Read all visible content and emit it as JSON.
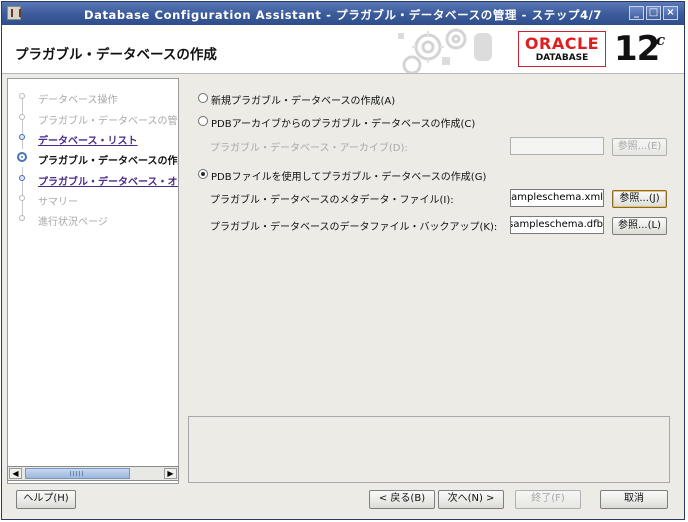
{
  "window": {
    "title": "Database Configuration Assistant - プラガブル・データベースの管理 - ステップ4/7",
    "controls": {
      "minimize": "_",
      "maximize": "□",
      "close": "×"
    }
  },
  "header": {
    "page_title": "プラガブル・データベースの作成",
    "logo_text": "ORACLE",
    "logo_sub": "DATABASE",
    "version": "12",
    "version_suffix": "c"
  },
  "steps": [
    {
      "label": "データベース操作",
      "state": "disabled"
    },
    {
      "label": "プラガブル・データベースの管理",
      "state": "disabled"
    },
    {
      "label": "データベース・リスト",
      "state": "link"
    },
    {
      "label": "プラガブル・データベースの作成",
      "state": "current"
    },
    {
      "label": "プラガブル・データベース・オプション",
      "state": "link"
    },
    {
      "label": "サマリー",
      "state": "disabled"
    },
    {
      "label": "進行状況ページ",
      "state": "disabled"
    }
  ],
  "options": {
    "new_pdb": {
      "label": "新規プラガブル・データベースの作成(A)",
      "selected": false
    },
    "from_archive": {
      "label": "PDBアーカイブからのプラガブル・データベースの作成(C)",
      "selected": false
    },
    "archive_field_label": "プラガブル・データベース・アーカイブ(D):",
    "archive_field_value": "",
    "archive_browse": "参照...(E)",
    "from_file": {
      "label": "PDBファイルを使用してプラガブル・データベースの作成(G)",
      "selected": true
    },
    "metadata_label": "プラガブル・データベースのメタデータ・ファイル(I):",
    "metadata_value": "sampleschema.xml",
    "metadata_browse": "参照...(J)",
    "datafile_label": "プラガブル・データベースのデータファイル・バックアップ(K):",
    "datafile_value": "sampleschema.dfb",
    "datafile_browse": "参照...(L)"
  },
  "footer": {
    "help": "ヘルプ(H)",
    "back": "< 戻る(B)",
    "next": "次へ(N) >",
    "finish": "終了(F)",
    "cancel": "取消"
  }
}
